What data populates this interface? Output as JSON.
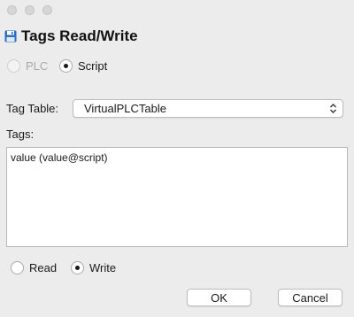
{
  "window": {
    "title": "Tags Read/Write",
    "icon": "floppy-disk-icon"
  },
  "source": {
    "options": [
      {
        "label": "PLC",
        "selected": false,
        "disabled": true
      },
      {
        "label": "Script",
        "selected": true,
        "disabled": false
      }
    ]
  },
  "tag_table": {
    "label": "Tag Table:",
    "value": "VirtualPLCTable"
  },
  "tags": {
    "label": "Tags:",
    "content": "value (value@script)"
  },
  "mode": {
    "options": [
      {
        "label": "Read",
        "selected": false
      },
      {
        "label": "Write",
        "selected": true
      }
    ]
  },
  "buttons": {
    "ok": "OK",
    "cancel": "Cancel"
  },
  "colors": {
    "background": "#ececec",
    "icon_blue": "#2b6cc4"
  }
}
